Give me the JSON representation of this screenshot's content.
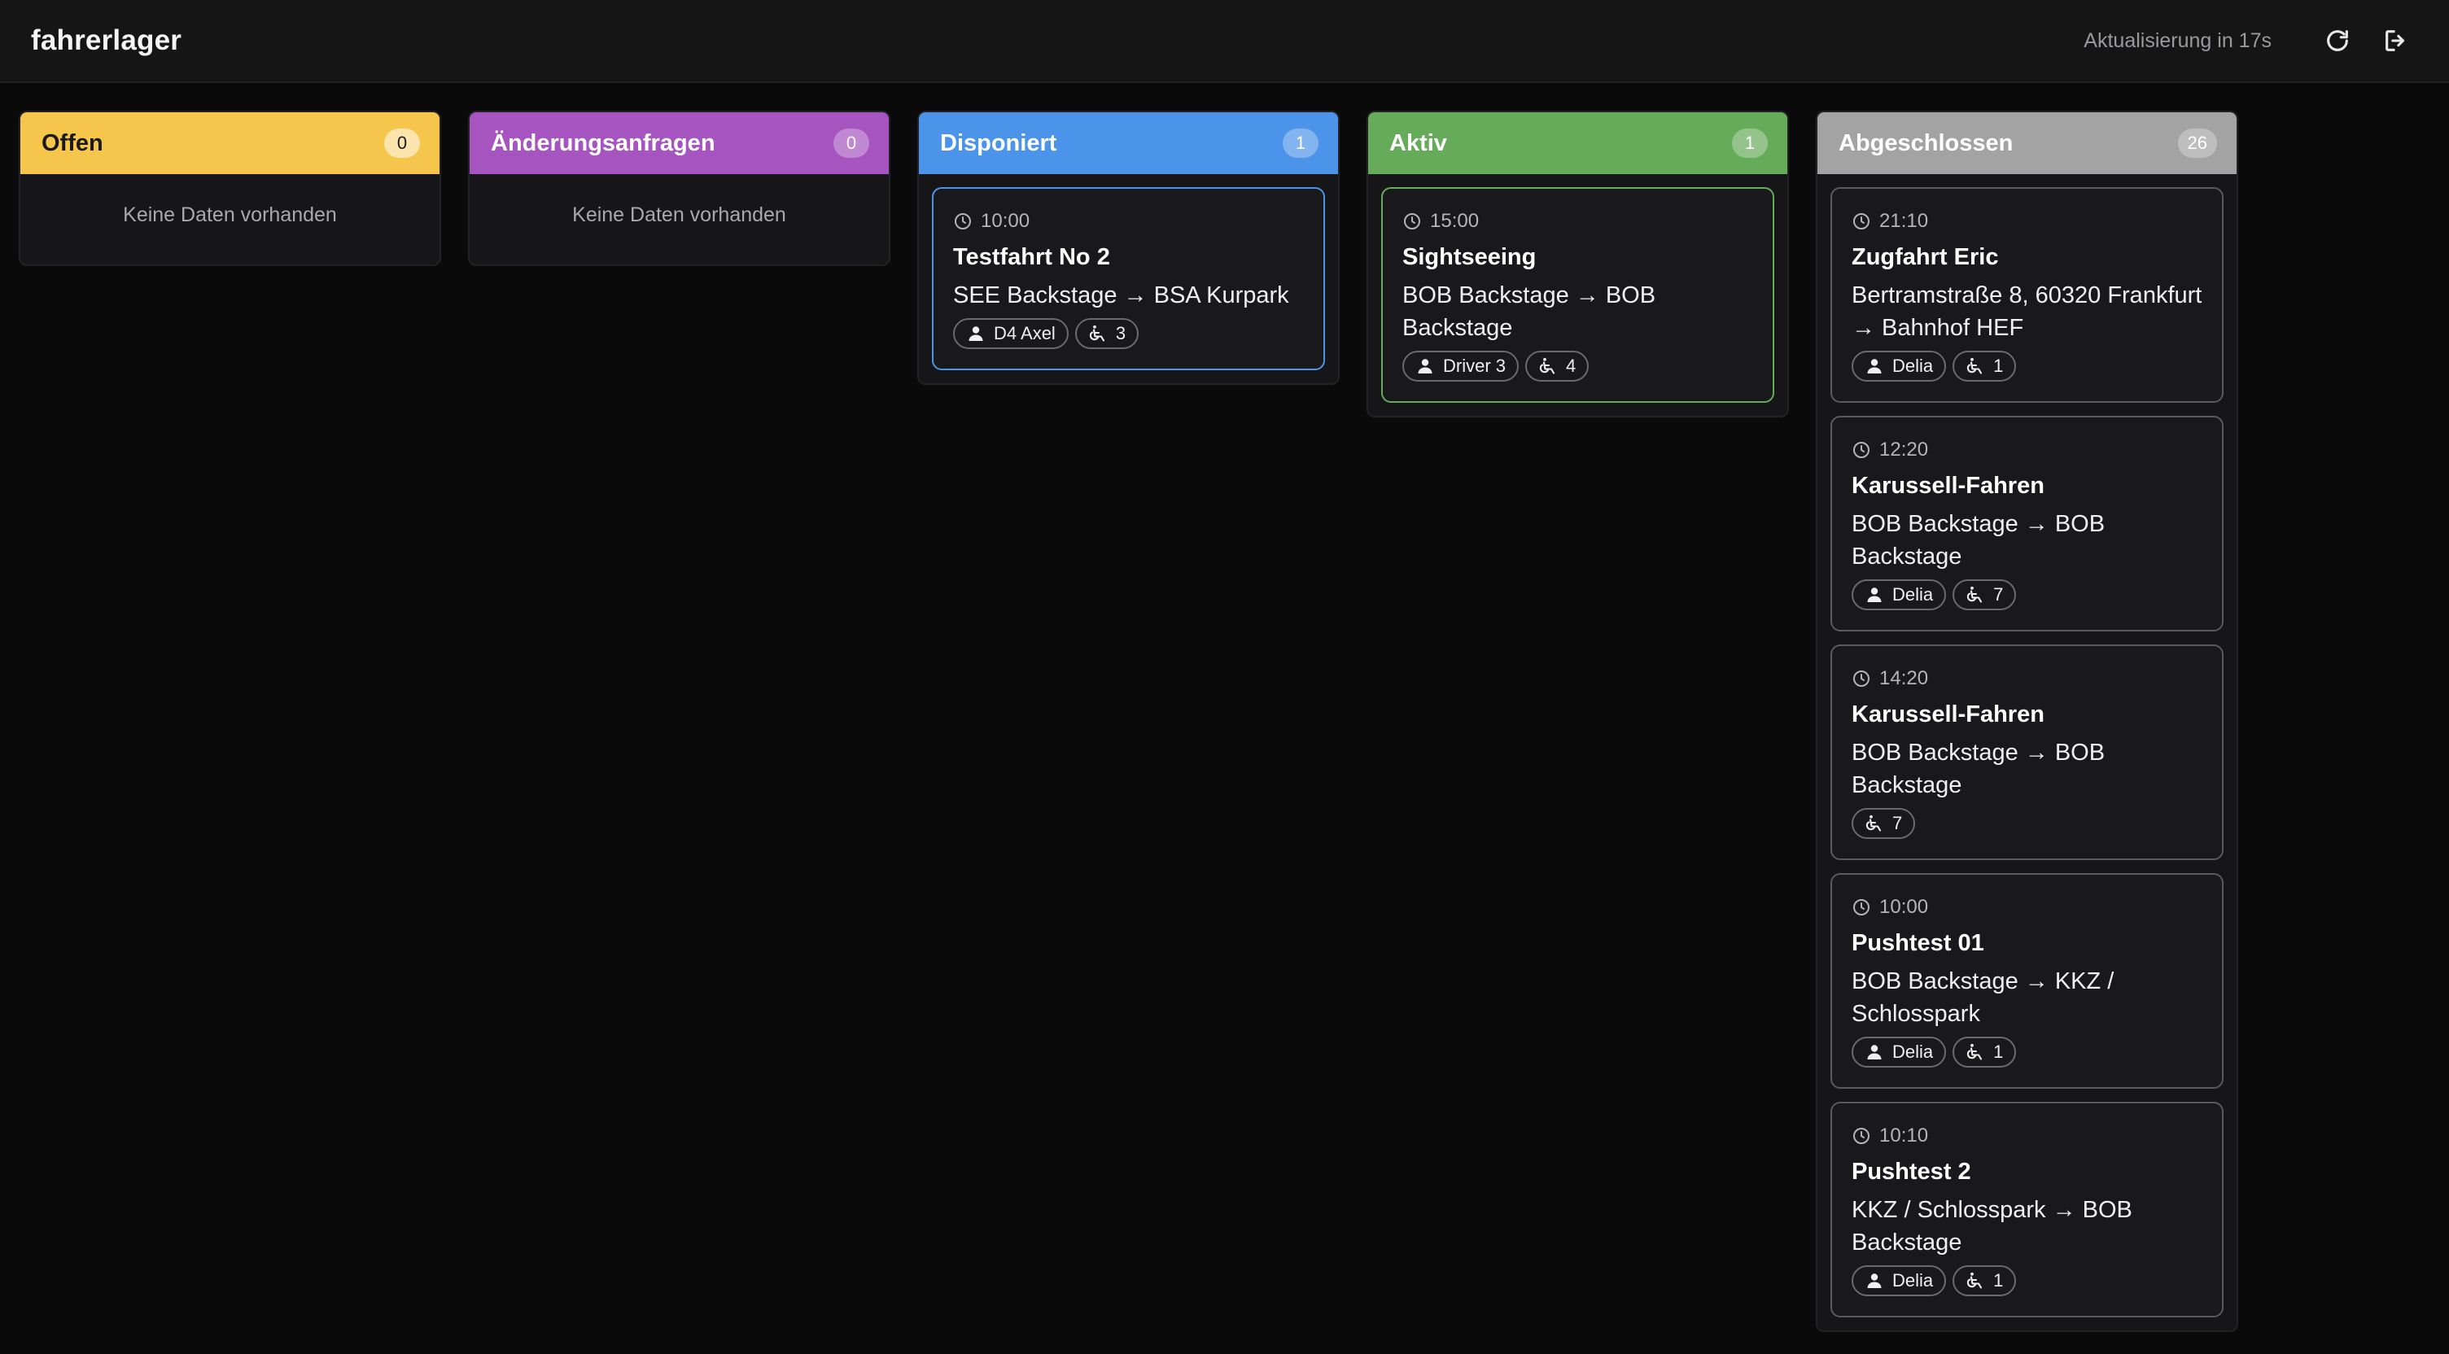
{
  "header": {
    "brand": "fahrerlager",
    "refresh_status": "Aktualisierung in 17s",
    "refresh_icon": "refresh-icon",
    "logout_icon": "logout-icon"
  },
  "colors": {
    "offen": "#f6c54b",
    "aenderungsanfragen": "#a554c0",
    "disponiert": "#4c94ea",
    "aktiv": "#66ab5a",
    "abgeschlossen": "#a3a3a3"
  },
  "columns": [
    {
      "key": "offen",
      "title": "Offen",
      "count": "0",
      "empty_text": "Keine Daten vorhanden",
      "cards": []
    },
    {
      "key": "aenderungsanfragen",
      "title": "Änderungsanfragen",
      "count": "0",
      "empty_text": "Keine Daten vorhanden",
      "cards": []
    },
    {
      "key": "disponiert",
      "title": "Disponiert",
      "count": "1",
      "empty_text": "",
      "cards": [
        {
          "time": "10:00",
          "title": "Testfahrt No 2",
          "route": "SEE Backstage → BSA Kurpark",
          "driver": "D4 Axel",
          "passengers": "3"
        }
      ]
    },
    {
      "key": "aktiv",
      "title": "Aktiv",
      "count": "1",
      "empty_text": "",
      "cards": [
        {
          "time": "15:00",
          "title": "Sightseeing",
          "route": "BOB Backstage → BOB Backstage",
          "driver": "Driver 3",
          "passengers": "4"
        }
      ]
    },
    {
      "key": "abgeschlossen",
      "title": "Abgeschlossen",
      "count": "26",
      "empty_text": "",
      "cards": [
        {
          "time": "21:10",
          "title": "Zugfahrt Eric",
          "route": "Bertramstraße 8, 60320 Frankfurt → Bahnhof HEF",
          "driver": "Delia",
          "passengers": "1"
        },
        {
          "time": "12:20",
          "title": "Karussell-Fahren",
          "route": "BOB Backstage → BOB Backstage",
          "driver": "Delia",
          "passengers": "7"
        },
        {
          "time": "14:20",
          "title": "Karussell-Fahren",
          "route": "BOB Backstage → BOB Backstage",
          "driver": "",
          "passengers": "7"
        },
        {
          "time": "10:00",
          "title": "Pushtest 01",
          "route": "BOB Backstage → KKZ / Schlosspark",
          "driver": "Delia",
          "passengers": "1"
        },
        {
          "time": "10:10",
          "title": "Pushtest 2",
          "route": "KKZ / Schlosspark → BOB Backstage",
          "driver": "Delia",
          "passengers": "1"
        }
      ]
    }
  ]
}
